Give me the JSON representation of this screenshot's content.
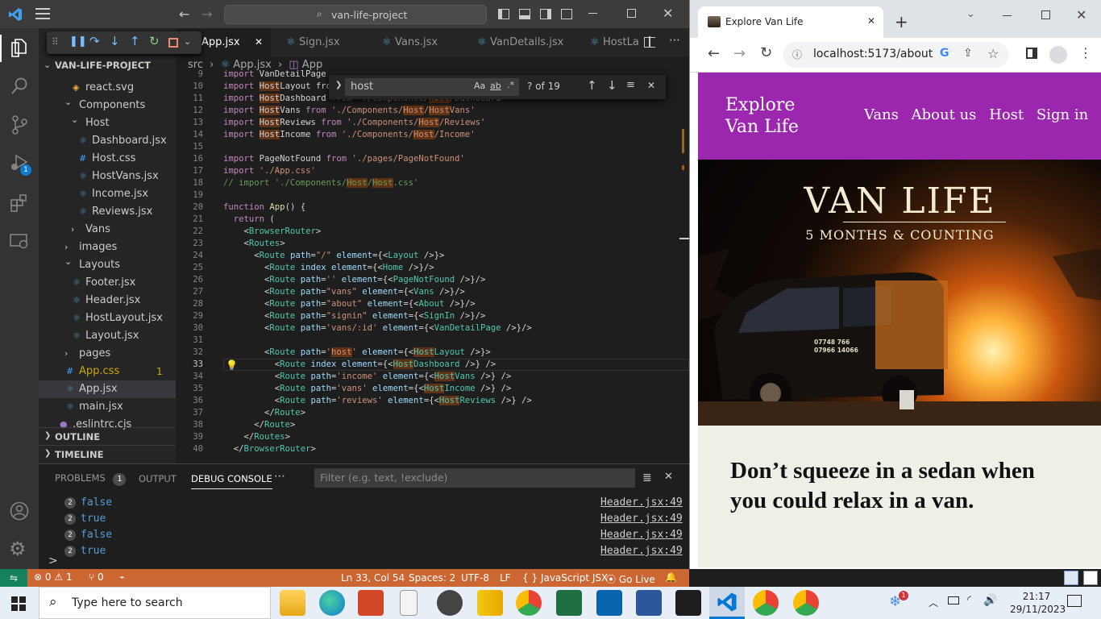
{
  "vscode": {
    "search_box": "van-life-project",
    "tabs": [
      "App.jsx",
      "Sign.jsx",
      "Vans.jsx",
      "VanDetails.jsx",
      "HostLay"
    ],
    "explorer": {
      "title": "VAN-LIFE-PROJECT",
      "items": [
        {
          "label": "react.svg",
          "indent": 2,
          "type": "file"
        },
        {
          "label": "Components",
          "indent": 1,
          "type": "folder-open"
        },
        {
          "label": "Host",
          "indent": 2,
          "type": "folder-open"
        },
        {
          "label": "Dashboard.jsx",
          "indent": 3,
          "type": "file"
        },
        {
          "label": "Host.css",
          "indent": 3,
          "type": "file"
        },
        {
          "label": "HostVans.jsx",
          "indent": 3,
          "type": "file"
        },
        {
          "label": "Income.jsx",
          "indent": 3,
          "type": "file"
        },
        {
          "label": "Reviews.jsx",
          "indent": 3,
          "type": "file"
        },
        {
          "label": "Vans",
          "indent": 2,
          "type": "folder"
        },
        {
          "label": "images",
          "indent": 1,
          "type": "folder"
        },
        {
          "label": "Layouts",
          "indent": 1,
          "type": "folder-open"
        },
        {
          "label": "Footer.jsx",
          "indent": 2,
          "type": "file"
        },
        {
          "label": "Header.jsx",
          "indent": 2,
          "type": "file"
        },
        {
          "label": "HostLayout.jsx",
          "indent": 2,
          "type": "file"
        },
        {
          "label": "Layout.jsx",
          "indent": 2,
          "type": "file"
        },
        {
          "label": "pages",
          "indent": 1,
          "type": "folder"
        },
        {
          "label": "App.css",
          "indent": 1,
          "type": "file",
          "badge": "1"
        },
        {
          "label": "App.jsx",
          "indent": 1,
          "type": "file",
          "selected": true
        },
        {
          "label": "main.jsx",
          "indent": 1,
          "type": "file"
        },
        {
          "label": ".eslintrc.cjs",
          "indent": 0,
          "type": "file"
        }
      ],
      "outline": "OUTLINE",
      "timeline": "TIMELINE"
    },
    "breadcrumb": {
      "part1": "src",
      "part2": "App.jsx",
      "part3": "App"
    },
    "find": {
      "query": "host",
      "count": "? of 19"
    },
    "code_lines": [
      {
        "n": "9",
        "t": "import VanDetailPage"
      },
      {
        "n": "10",
        "t": "import HostLayout fro"
      },
      {
        "n": "11",
        "t": "import HostDashboard from './Components/Host/Dashboard'"
      },
      {
        "n": "12",
        "t": "import HostVans from './Components/Host/HostVans'"
      },
      {
        "n": "13",
        "t": "import HostReviews from './Components/Host/Reviews'"
      },
      {
        "n": "14",
        "t": "import HostIncome from './Components/Host/Income'"
      },
      {
        "n": "15",
        "t": ""
      },
      {
        "n": "16",
        "t": "import PageNotFound from './pages/PageNotFound'"
      },
      {
        "n": "17",
        "t": "import './App.css'"
      },
      {
        "n": "18",
        "t": "// import './Components/Host/Host.css'"
      },
      {
        "n": "19",
        "t": ""
      },
      {
        "n": "20",
        "t": "function App() {"
      },
      {
        "n": "21",
        "t": "  return ("
      },
      {
        "n": "22",
        "t": "    <BrowserRouter>"
      },
      {
        "n": "23",
        "t": "    <Routes>"
      },
      {
        "n": "24",
        "t": "      <Route path=\"/\" element={<Layout />}>"
      },
      {
        "n": "25",
        "t": "        <Route index element={<Home />}/>"
      },
      {
        "n": "26",
        "t": "        <Route path='' element={<PageNotFound />}/>"
      },
      {
        "n": "27",
        "t": "        <Route path=\"vans\" element={<Vans />}/>"
      },
      {
        "n": "28",
        "t": "        <Route path=\"about\" element={<About />}/>"
      },
      {
        "n": "29",
        "t": "        <Route path=\"signin\" element={<SignIn />}/>"
      },
      {
        "n": "30",
        "t": "        <Route path='vans/:id' element={<VanDetailPage />}/>"
      },
      {
        "n": "31",
        "t": ""
      },
      {
        "n": "32",
        "t": "        <Route path='host' element={<HostLayout />}>"
      },
      {
        "n": "33",
        "t": "          <Route index element={<HostDashboard />} />"
      },
      {
        "n": "34",
        "t": "          <Route path='income' element={<HostVans />} />"
      },
      {
        "n": "35",
        "t": "          <Route path='vans' element={<HostIncome />} />"
      },
      {
        "n": "36",
        "t": "          <Route path='reviews' element={<HostReviews />} />"
      },
      {
        "n": "37",
        "t": "        </Route>"
      },
      {
        "n": "38",
        "t": "      </Route>"
      },
      {
        "n": "39",
        "t": "    </Routes>"
      },
      {
        "n": "40",
        "t": "  </BrowserRouter>"
      }
    ],
    "panel": {
      "tabs": [
        "PROBLEMS",
        "OUTPUT",
        "DEBUG CONSOLE"
      ],
      "problems_count": "1",
      "filter_placeholder": "Filter (e.g. text, !exclude)",
      "lines": [
        {
          "count": "2",
          "value": "false",
          "src": "Header.jsx:49"
        },
        {
          "count": "2",
          "value": "true",
          "src": "Header.jsx:49"
        },
        {
          "count": "2",
          "value": "false",
          "src": "Header.jsx:49"
        },
        {
          "count": "2",
          "value": "true",
          "src": "Header.jsx:49"
        }
      ],
      "prompt": ">"
    },
    "status": {
      "errors": "0",
      "warnings": "1",
      "ports": "0",
      "position": "Ln 33, Col 54",
      "spaces": "Spaces: 2",
      "encoding": "UTF-8",
      "eol": "LF",
      "language": "JavaScript JSX",
      "golive": "Go Live",
      "debug_badge": "1"
    }
  },
  "browser": {
    "tab_title": "Explore Van Life",
    "url": "localhost:5173/about",
    "site": {
      "logo_line1": "Explore",
      "logo_line2": "Van Life",
      "nav": [
        "Vans",
        "About us",
        "Host",
        "Sign in"
      ],
      "hero_title": "VAN LIFE",
      "hero_sub": "5 MONTHS & COUNTING",
      "van_text1": "07748 766",
      "van_text2": "07966 14066",
      "headline": "Don’t squeeze in a sedan when you could relax in a van.",
      "accent": "#9b27af",
      "body_bg": "#eeefe6"
    }
  },
  "taskbar": {
    "search_placeholder": "Type here to search",
    "time": "21:17",
    "date": "29/11/2023",
    "weather_badge": "1"
  }
}
